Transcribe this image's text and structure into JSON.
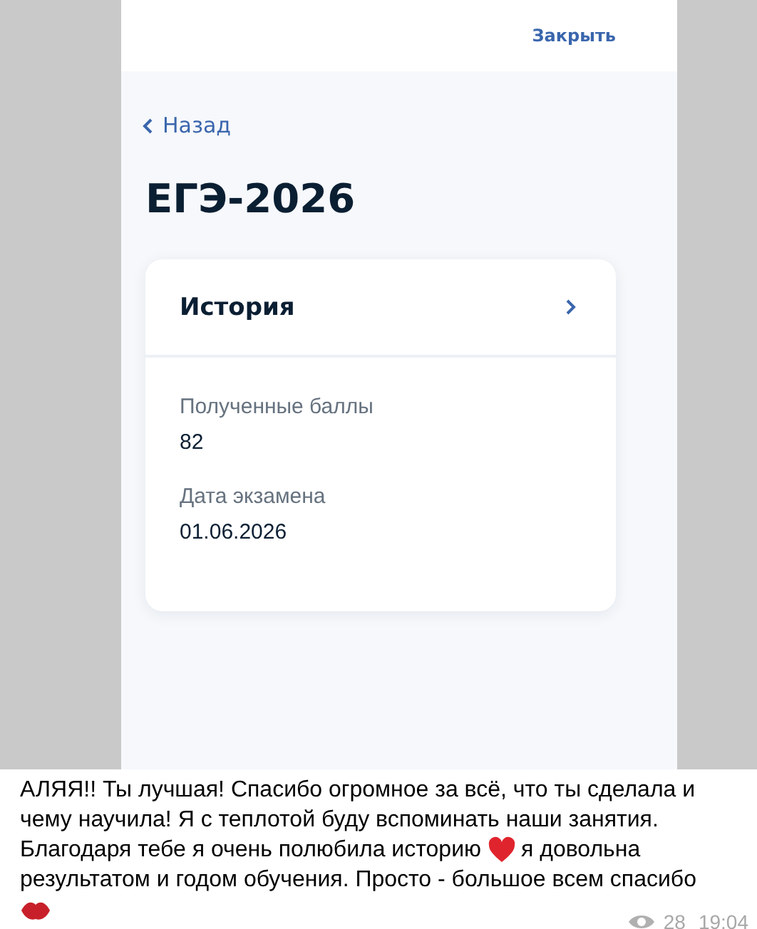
{
  "phone": {
    "close_link": "Закрыть",
    "back_link": "Назад",
    "title": "ЕГЭ-2026",
    "card": {
      "subject": "История",
      "fields": [
        {
          "label": "Полученные баллы",
          "value": "82"
        },
        {
          "label": "Дата экзамена",
          "value": "01.06.2026"
        }
      ]
    }
  },
  "message": {
    "lines": [
      [
        {
          "kind": "text",
          "text": "АЛЯЯ!! Ты лучшая! Спасибо огромное за всё, что ты сделала и"
        }
      ],
      [
        {
          "kind": "text",
          "text": "чему научила! Я с теплотой буду вспоминать наши занятия."
        }
      ],
      [
        {
          "kind": "text",
          "text": "Благодаря тебе я очень полюбила историю"
        },
        {
          "kind": "heart"
        },
        {
          "kind": "text",
          "text": "я довольна"
        }
      ],
      [
        {
          "kind": "text",
          "text": "результатом и годом обучения. Просто - большое всем спасибо"
        }
      ],
      [
        {
          "kind": "lips"
        }
      ]
    ],
    "views": "28",
    "time": "19:04"
  }
}
